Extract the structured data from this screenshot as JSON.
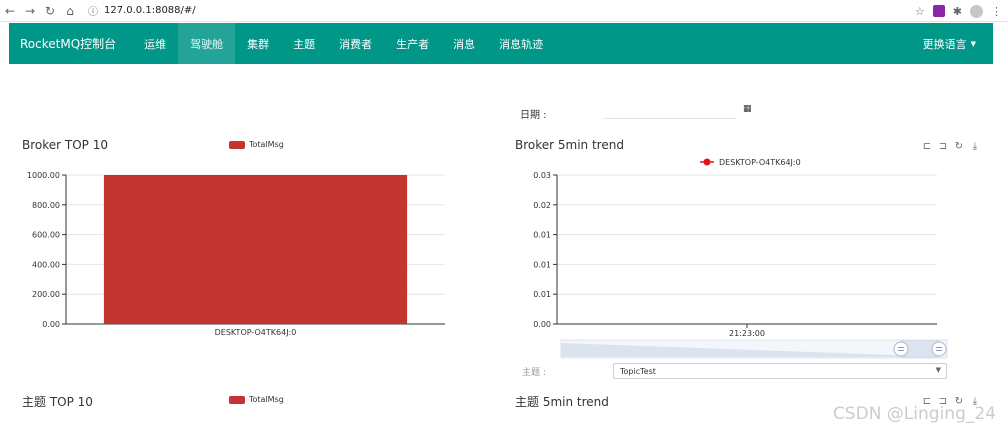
{
  "browser": {
    "url": "127.0.0.1:8088/#/",
    "info_icon": "info-icon"
  },
  "nav": {
    "brand": "RocketMQ控制台",
    "items": [
      {
        "label": "运维",
        "active": false
      },
      {
        "label": "驾驶舱",
        "active": true
      },
      {
        "label": "集群",
        "active": false
      },
      {
        "label": "主题",
        "active": false
      },
      {
        "label": "消费者",
        "active": false
      },
      {
        "label": "生产者",
        "active": false
      },
      {
        "label": "消息",
        "active": false
      },
      {
        "label": "消息轨迹",
        "active": false
      }
    ],
    "language": "更换语言"
  },
  "date": {
    "label": "日期 :",
    "value": ""
  },
  "charts": {
    "broker_top10_title": "Broker TOP 10",
    "broker_trend_title": "Broker 5min trend",
    "topic_top10_title": "主题 TOP 10",
    "topic_trend_title": "主题 5min trend",
    "legend_total": "TotalMsg"
  },
  "topic": {
    "label": "主题 :",
    "selected": "TopicTest"
  },
  "watermark": "CSDN @Linging_24",
  "chart_data": [
    {
      "type": "bar",
      "title": "Broker TOP 10",
      "categories": [
        "DESKTOP-O4TK64J:0"
      ],
      "series": [
        {
          "name": "TotalMsg",
          "values": [
            1000
          ]
        }
      ],
      "yticks": [
        "0.00",
        "200.00",
        "400.00",
        "600.00",
        "800.00",
        "1000.00"
      ],
      "ylim": [
        0,
        1000
      ],
      "color": "#c23531",
      "grid": true,
      "legend": "top-center"
    },
    {
      "type": "line",
      "title": "Broker 5min trend",
      "x": [
        "21:23:00"
      ],
      "series": [
        {
          "name": "DESKTOP-O4TK64J:0",
          "values": []
        }
      ],
      "yticks": [
        "0.00",
        "0.01",
        "0.01",
        "0.01",
        "0.02",
        "0.03"
      ],
      "ylim": [
        0,
        0.03
      ],
      "color": "#e01515",
      "grid": true,
      "legend": "top-center"
    }
  ]
}
